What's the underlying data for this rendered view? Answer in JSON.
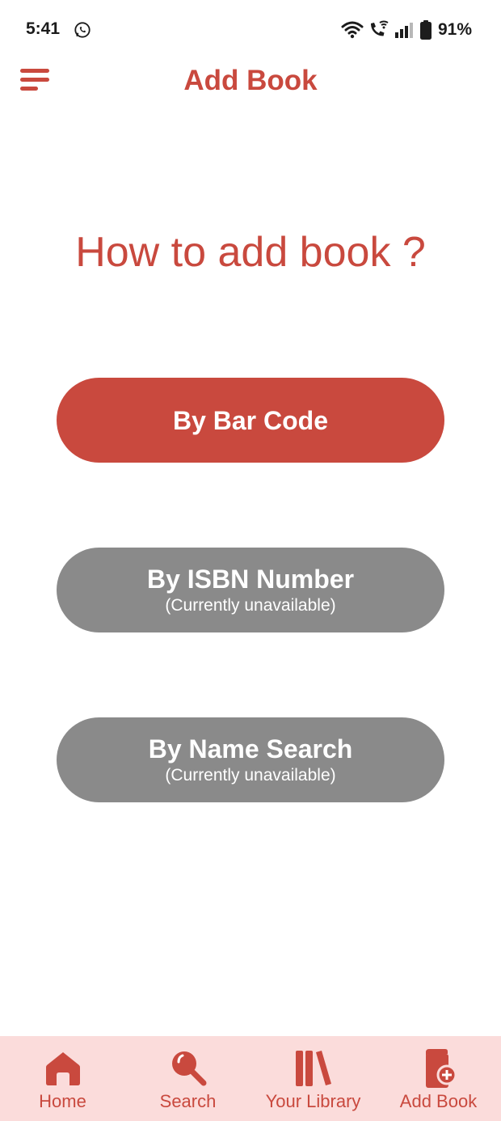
{
  "status_bar": {
    "time": "5:41",
    "battery": "91%",
    "icons": [
      "whatsapp-icon",
      "wifi-icon",
      "wifi-calling-icon",
      "signal-icon",
      "battery-icon"
    ]
  },
  "app_bar": {
    "title": "Add Book",
    "menu_icon": "menu-icon"
  },
  "main": {
    "headline": "How to add book ?",
    "options": [
      {
        "label": "By Bar Code",
        "sublabel": "",
        "enabled": true
      },
      {
        "label": "By ISBN Number",
        "sublabel": "(Currently unavailable)",
        "enabled": false
      },
      {
        "label": "By Name Search",
        "sublabel": "(Currently unavailable)",
        "enabled": false
      }
    ]
  },
  "bottom_nav": {
    "items": [
      {
        "label": "Home",
        "icon": "home-icon"
      },
      {
        "label": "Search",
        "icon": "search-icon"
      },
      {
        "label": "Your Library",
        "icon": "library-icon"
      },
      {
        "label": "Add Book",
        "icon": "add-book-icon"
      }
    ]
  },
  "colors": {
    "accent": "#c9493e",
    "disabled": "#8a8a8a",
    "nav_background": "#fbdcdb",
    "text_dark": "#1c1c1c"
  }
}
